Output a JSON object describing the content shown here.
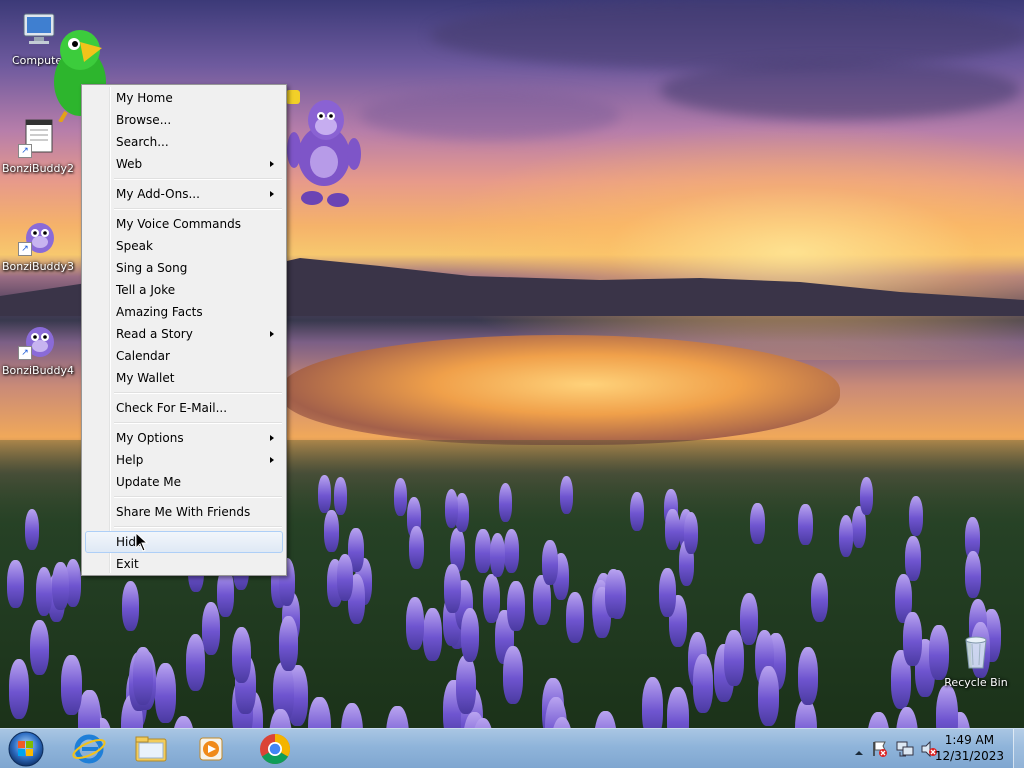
{
  "desktop": {
    "icons": [
      {
        "label": "Computer",
        "icon": "computer-icon"
      },
      {
        "label": "BonziBuddy2",
        "icon": "bonzibuddy-shortcut-icon"
      },
      {
        "label": "BonziBuddy3",
        "icon": "bonzibuddy-shortcut-icon"
      },
      {
        "label": "BonziBuddy4",
        "icon": "bonzibuddy-shortcut-icon"
      },
      {
        "label": "Recycle Bin",
        "icon": "recycle-bin-icon"
      }
    ],
    "characters": [
      "green-parrot-character",
      "purple-gorilla-character"
    ]
  },
  "context_menu": {
    "items": [
      {
        "label": "My Home",
        "submenu": false
      },
      {
        "label": "Browse...",
        "submenu": false
      },
      {
        "label": "Search...",
        "submenu": false
      },
      {
        "label": "Web",
        "submenu": true
      },
      {
        "label": "My Add-Ons...",
        "submenu": true
      },
      {
        "label": "My Voice Commands",
        "submenu": false
      },
      {
        "label": "Speak",
        "submenu": false
      },
      {
        "label": "Sing a Song",
        "submenu": false
      },
      {
        "label": "Tell a Joke",
        "submenu": false
      },
      {
        "label": "Amazing Facts",
        "submenu": false
      },
      {
        "label": "Read a Story",
        "submenu": true
      },
      {
        "label": "Calendar",
        "submenu": false
      },
      {
        "label": "My Wallet",
        "submenu": false
      },
      {
        "label": "Check For E-Mail...",
        "submenu": false
      },
      {
        "label": "My Options",
        "submenu": true
      },
      {
        "label": "Help",
        "submenu": true
      },
      {
        "label": "Update Me",
        "submenu": false
      },
      {
        "label": "Share Me With Friends",
        "submenu": false
      },
      {
        "label": "Hide",
        "submenu": false,
        "hovered": true
      },
      {
        "label": "Exit",
        "submenu": false
      }
    ]
  },
  "taskbar": {
    "start_icon": "windows-start-icon",
    "pinned": [
      "internet-explorer-icon",
      "file-explorer-icon",
      "media-player-icon",
      "chrome-icon"
    ],
    "tray_icons": [
      "show-hidden-icons-chevron",
      "action-center-flag-icon",
      "network-icon",
      "volume-muted-icon"
    ],
    "clock_time": "1:49 AM",
    "clock_date": "12/31/2023"
  },
  "colors": {
    "menu_background": "#f0f0f0",
    "menu_hover": "#dfe9f5",
    "taskbar": "#8fb4da"
  }
}
